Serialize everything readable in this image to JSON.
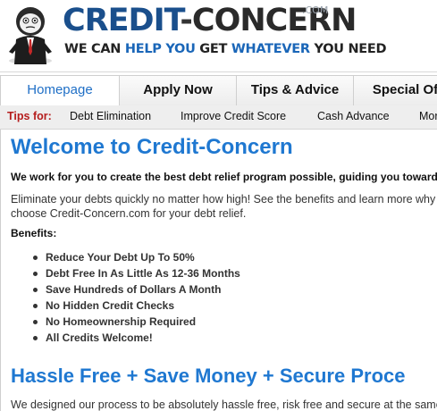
{
  "header": {
    "logo_brand": "CREDIT",
    "logo_dash": "-",
    "logo_name": "CONCERN",
    "logo_tld": ".COM",
    "tagline": [
      {
        "text": "WE CAN ",
        "blue": false
      },
      {
        "text": "HELP YOU",
        "blue": true
      },
      {
        "text": " GET ",
        "blue": false
      },
      {
        "text": "WHATEVER",
        "blue": true
      },
      {
        "text": " YOU NEED",
        "blue": false
      }
    ]
  },
  "nav": {
    "tabs": [
      {
        "label": "Homepage",
        "active": true
      },
      {
        "label": "Apply Now",
        "active": false
      },
      {
        "label": "Tips & Advice",
        "active": false
      },
      {
        "label": "Special Off",
        "active": false
      }
    ]
  },
  "tips": {
    "label": "Tips for:",
    "links": [
      "Debt Elimination",
      "Improve Credit Score",
      "Cash Advance",
      "Mor"
    ]
  },
  "main": {
    "title": "Welcome to Credit-Concern",
    "lead": "We work for you to create the best debt relief program possible, guiding you toward f",
    "paragraph": "Eliminate your debts quickly no matter how high! See the benefits and learn more why to choose Credit-Concern.com for your debt relief.",
    "benefits_label": "Benefits:",
    "benefits": [
      "Reduce Your Debt Up To 50%",
      "Debt Free In As Little As 12-36 Months",
      "Save Hundreds of Dollars A Month",
      "No Hidden Credit Checks",
      "No Homeownership Required",
      "All Credits Welcome!"
    ],
    "section2_title": "Hassle Free + Save Money + Secure Proce",
    "section2_text": "We designed our process to be absolutely hassle free, risk free and secure at the same ti"
  },
  "colors": {
    "accent_blue": "#1f78d1",
    "logo_blue": "#1a4f8c",
    "tips_red": "#b51d1d"
  },
  "icons": {
    "mascot": "businessman-mascot-icon"
  }
}
